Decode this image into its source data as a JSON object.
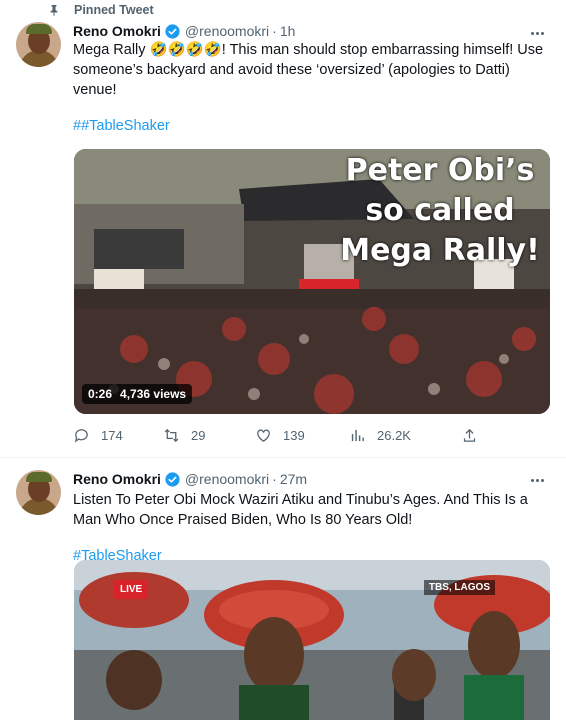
{
  "pinned_label": "Pinned Tweet",
  "tweet1": {
    "name": "Reno Omokri",
    "handle": "@renoomokri",
    "separator": "·",
    "time": "1h",
    "text": "Mega Rally 🤣🤣🤣🤣! This man should stop embarrassing himself! Use someone’s backyard and avoid these ‘oversized’ (apologies to Datti) venue!",
    "hashtag": "##TableShaker",
    "media_overlay": "Peter Obi’s so called Mega Rally!",
    "video_duration": "0:26",
    "video_views": "4,736 views",
    "replies": "174",
    "retweets": "29",
    "likes": "139",
    "views": "26.2K"
  },
  "tweet2": {
    "name": "Reno Omokri",
    "handle": "@renoomokri",
    "separator": "·",
    "time": "27m",
    "text": "Listen To Peter Obi Mock Waziri Atiku and Tinubu’s Ages. And This Is a Man Who Once Praised Biden, Who Is 80 Years Old!",
    "hashtag": "#TableShaker",
    "live_badge": "LIVE",
    "channel_tag": "TBS, LAGOS"
  },
  "colors": {
    "link": "#1d9bf0",
    "secondary_text": "#536471",
    "verified": "#1d9bf0"
  }
}
